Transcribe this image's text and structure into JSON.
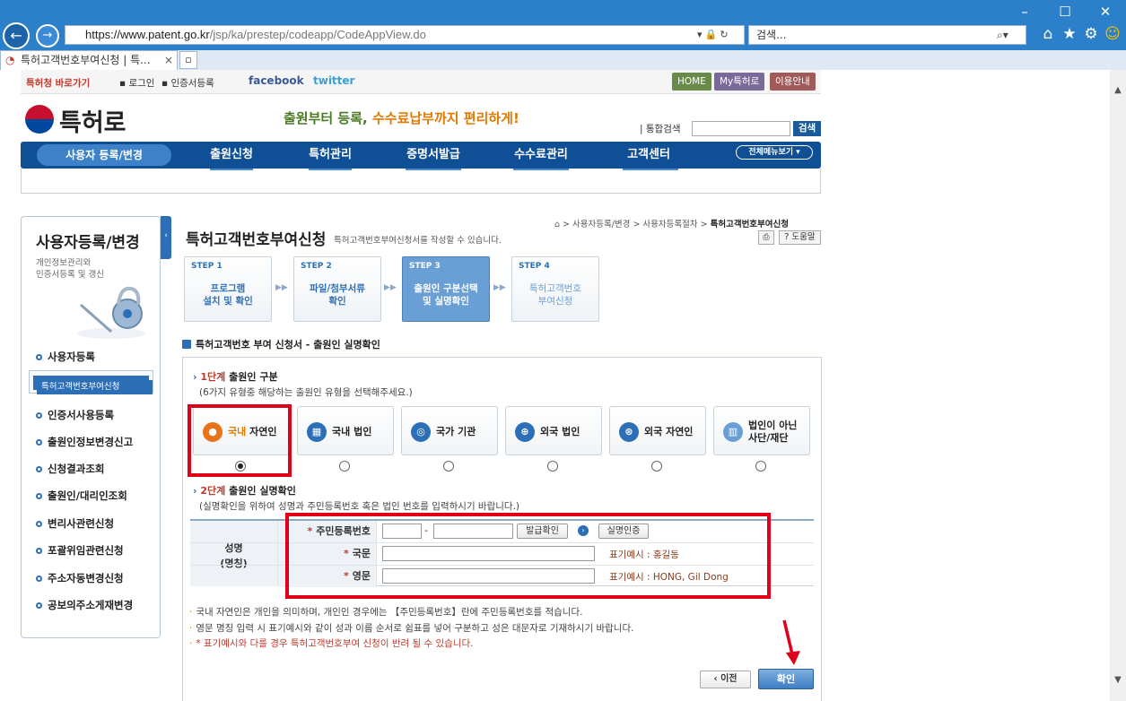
{
  "browser": {
    "url_host": "https://www.patent.go.kr",
    "url_path": "/jsp/ka/prestep/codeapp/CodeAppView.do",
    "search_placeholder": "검색...",
    "tab_title": "특허고객번호부여신청 | 특...",
    "tab_close": "×"
  },
  "util": {
    "shortcut": "특허청 바로가기",
    "login": "로그인",
    "cert": "인증서등록",
    "facebook": "facebook",
    "twitter": "twitter",
    "home": "HOME",
    "mypatent": "My특허로",
    "guide": "이용안내"
  },
  "header": {
    "logo": "특허로",
    "slogan_a": "출원부터 등록, ",
    "slogan_b": "수수료납부까지 편리하게!",
    "search_label": "통합검색",
    "search_btn": "검색",
    "all_menu": "전체메뉴보기"
  },
  "gnb": [
    "사용자 등록/변경",
    "출원신청",
    "특허관리",
    "증명서발급",
    "수수료관리",
    "고객센터"
  ],
  "lnb": {
    "title": "사용자등록/변경",
    "desc1": "개인정보관리와",
    "desc2": "인증서등록 및 갱신",
    "items": [
      "사용자등록",
      "특허고객번호부여신청",
      "인증서사용등록",
      "출원인정보변경신고",
      "신청결과조회",
      "출원인/대리인조회",
      "변리사관련신청",
      "포괄위임관련신청",
      "주소자동변경신청",
      "공보의주소게재변경"
    ]
  },
  "content": {
    "title": "특허고객번호부여신청",
    "desc": "특허고객번호부여신청서를 작성할 수 있습니다.",
    "bread1": "사용자등록/변경",
    "bread2": "사용자등록절차",
    "bread3": "특허고객번호부여신청",
    "print": "⎙",
    "help": "? 도움말",
    "steps": [
      {
        "no": "STEP 1",
        "l1": "프로그램",
        "l2": "설치 및 확인"
      },
      {
        "no": "STEP 2",
        "l1": "파일/첨부서류",
        "l2": "확인"
      },
      {
        "no": "STEP 3",
        "l1": "출원인 구분선택",
        "l2": "및 실명확인"
      },
      {
        "no": "STEP 4",
        "l1": "특허고객번호",
        "l2": "부여신청"
      }
    ],
    "section": "특허고객번호 부여 신청서 - 출원인 실명확인",
    "stage1_num": "1단계",
    "stage1": "출원인 구분",
    "stage1_sub": "(6가지 유형중 해당하는 출원인 유형을 선택해주세요.)",
    "types": [
      {
        "a": "국내",
        "b": "자연인"
      },
      {
        "a": "국내 법인",
        "b": ""
      },
      {
        "a": "국가 기관",
        "b": ""
      },
      {
        "a": "외국 법인",
        "b": ""
      },
      {
        "a": "외국 자연인",
        "b": ""
      },
      {
        "a": "법인이 아닌",
        "b": "사단/재단"
      }
    ],
    "stage2_num": "2단계",
    "stage2": "출원인 실명확인",
    "stage2_sub": "(실명확인을 위하여 성명과 주민등록번호 혹은 법인 번호를 입력하시기 바랍니다.)",
    "name_l1": "성명",
    "name_l2": "(명칭)",
    "rrn_label": "주민등록번호",
    "dash": "-",
    "issue_btn": "발급확인",
    "verify_btn": "실명인증",
    "kr_label": "국문",
    "kr_example": "표기예시 : 홍길동",
    "en_label": "영문",
    "en_example": "표기예시 : HONG, Gil Dong",
    "notes": [
      "국내 자연인은 개인을 의미하며, 개인인 경우에는 【주민등록번호】란에 주민등록번호를 적습니다.",
      "영문 명칭 입력 시 표기예시와 같이 성과 이름 순서로 쉼표를 넣어 구분하고 성은 대문자로 기재하시기 바랍니다.",
      "* 표기예시와 다를 경우 특허고객번호부여 신청이 반려 될 수 있습니다."
    ],
    "prev": "‹ 이전",
    "ok": "확인"
  },
  "colors": {
    "accent": "#2d6fb7",
    "highlight": "#e0001a",
    "gnb": "#0e4f96"
  }
}
